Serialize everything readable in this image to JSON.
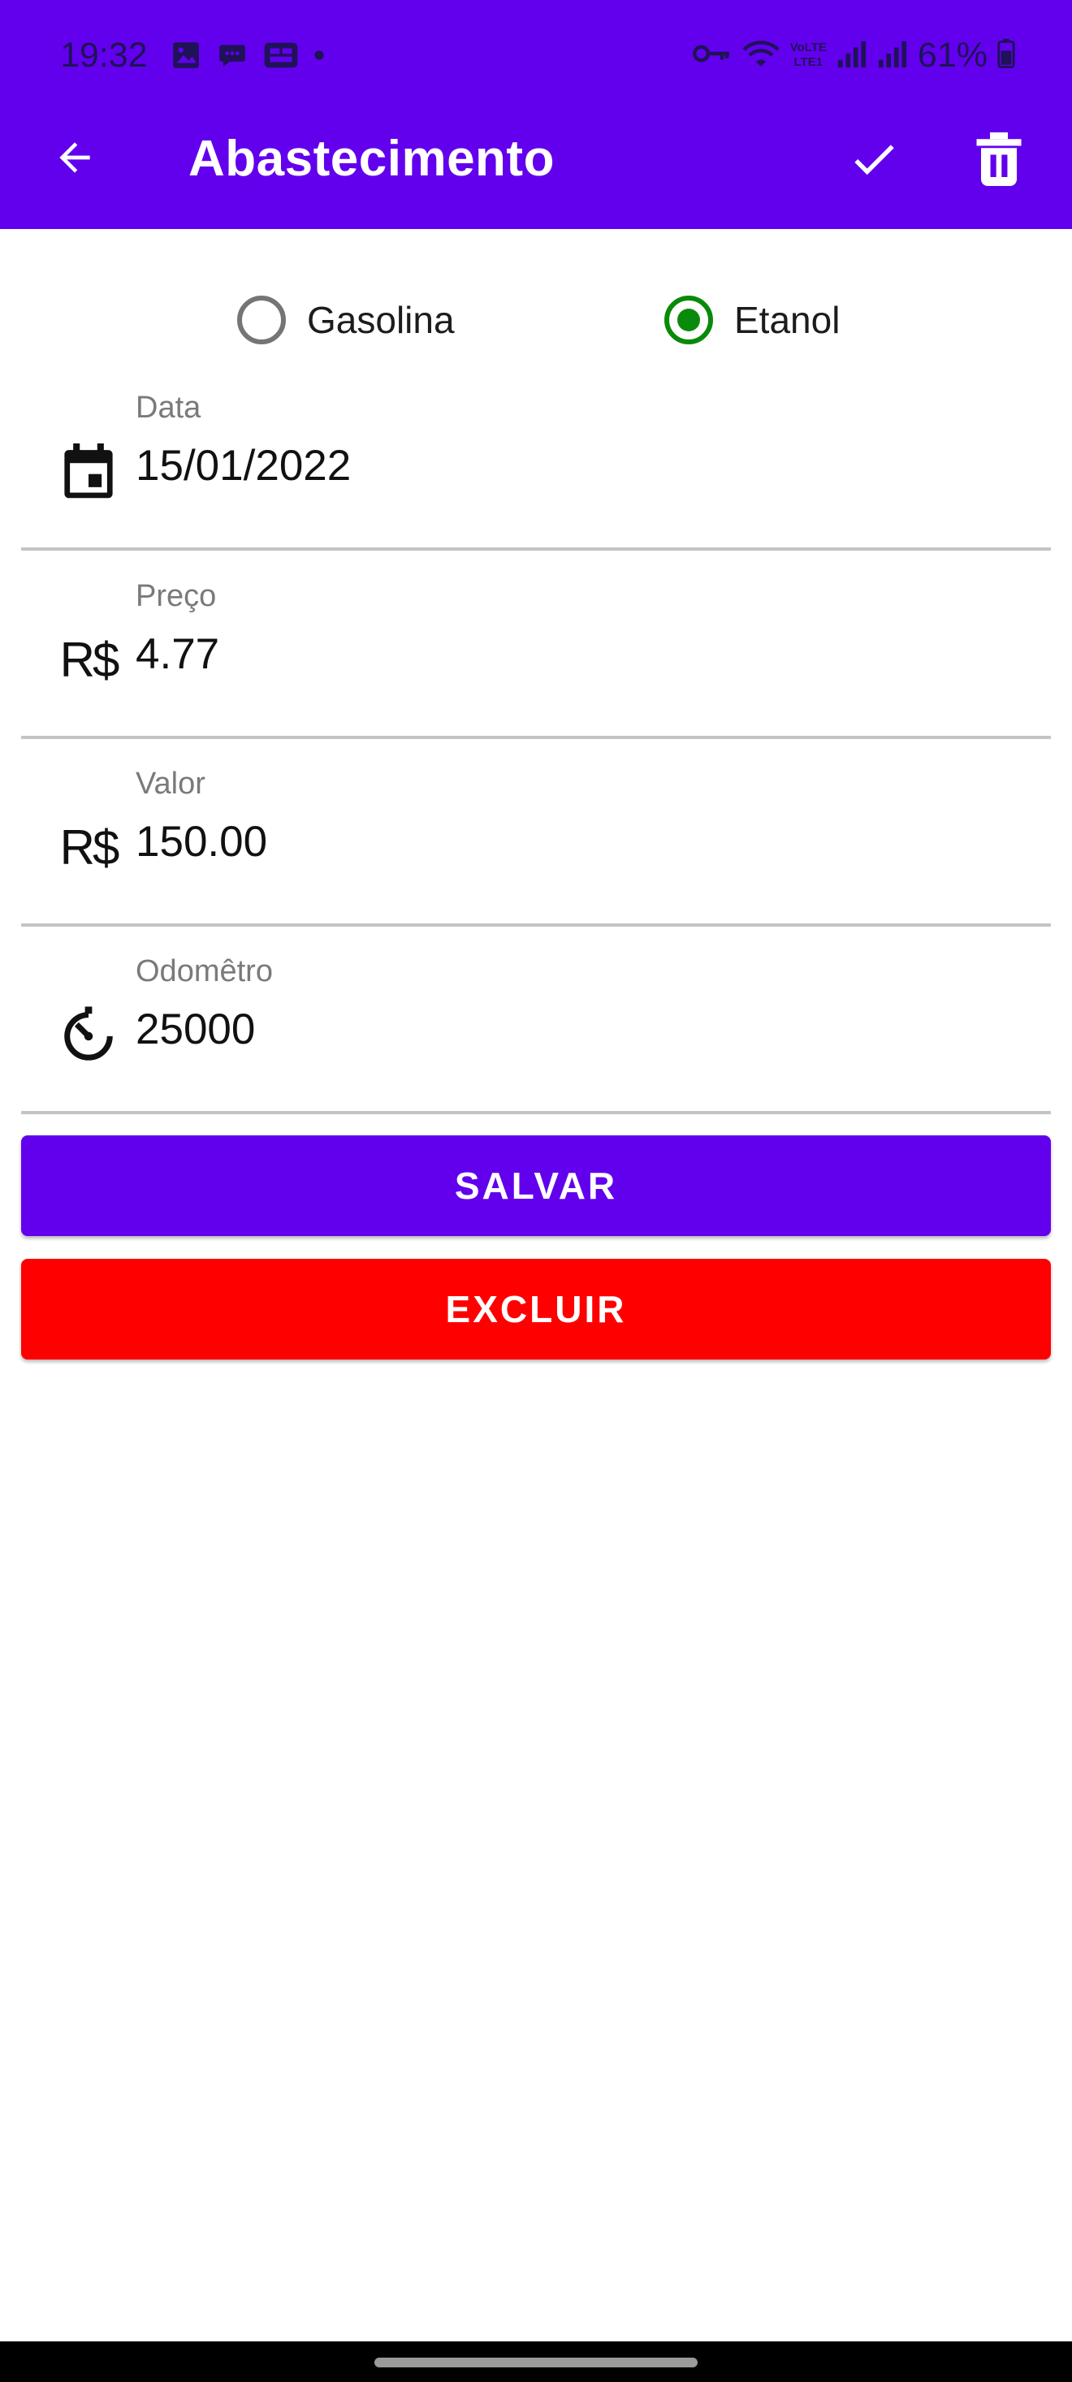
{
  "status_bar": {
    "time": "19:32",
    "battery_text": "61%",
    "left_icons": [
      "gallery-icon",
      "chat-icon",
      "bug-icon",
      "notification-dot-icon"
    ],
    "right_icons": [
      "key-icon",
      "wifi-icon",
      "volte-icon",
      "signal-icon",
      "signal-icon",
      "battery-icon"
    ],
    "volte_text_top": "VoLTE",
    "volte_text_bottom": "LTE1"
  },
  "app_bar": {
    "title": "Abastecimento",
    "back_icon": "arrow-back-icon",
    "confirm_icon": "check-icon",
    "delete_icon": "trash-icon",
    "background": "#6200EE"
  },
  "fuel_type": {
    "options": [
      {
        "label": "Gasolina",
        "checked": false
      },
      {
        "label": "Etanol",
        "checked": true
      }
    ],
    "checked_color": "#0A8A0A"
  },
  "fields": [
    {
      "id": "data",
      "label": "Data",
      "value": "15/01/2022",
      "icon": "calendar-icon"
    },
    {
      "id": "preco",
      "label": "Preço",
      "value": "4.77",
      "icon": "currency-real-icon",
      "icon_text": "R$"
    },
    {
      "id": "valor",
      "label": "Valor",
      "value": "150.00",
      "icon": "currency-real-icon",
      "icon_text": "R$"
    },
    {
      "id": "odometro",
      "label": "Odomêtro",
      "value": "25000",
      "icon": "timer-icon"
    }
  ],
  "buttons": {
    "save_label": "SALVAR",
    "save_color": "#6200EE",
    "delete_label": "EXCLUIR",
    "delete_color": "#FF0000"
  }
}
